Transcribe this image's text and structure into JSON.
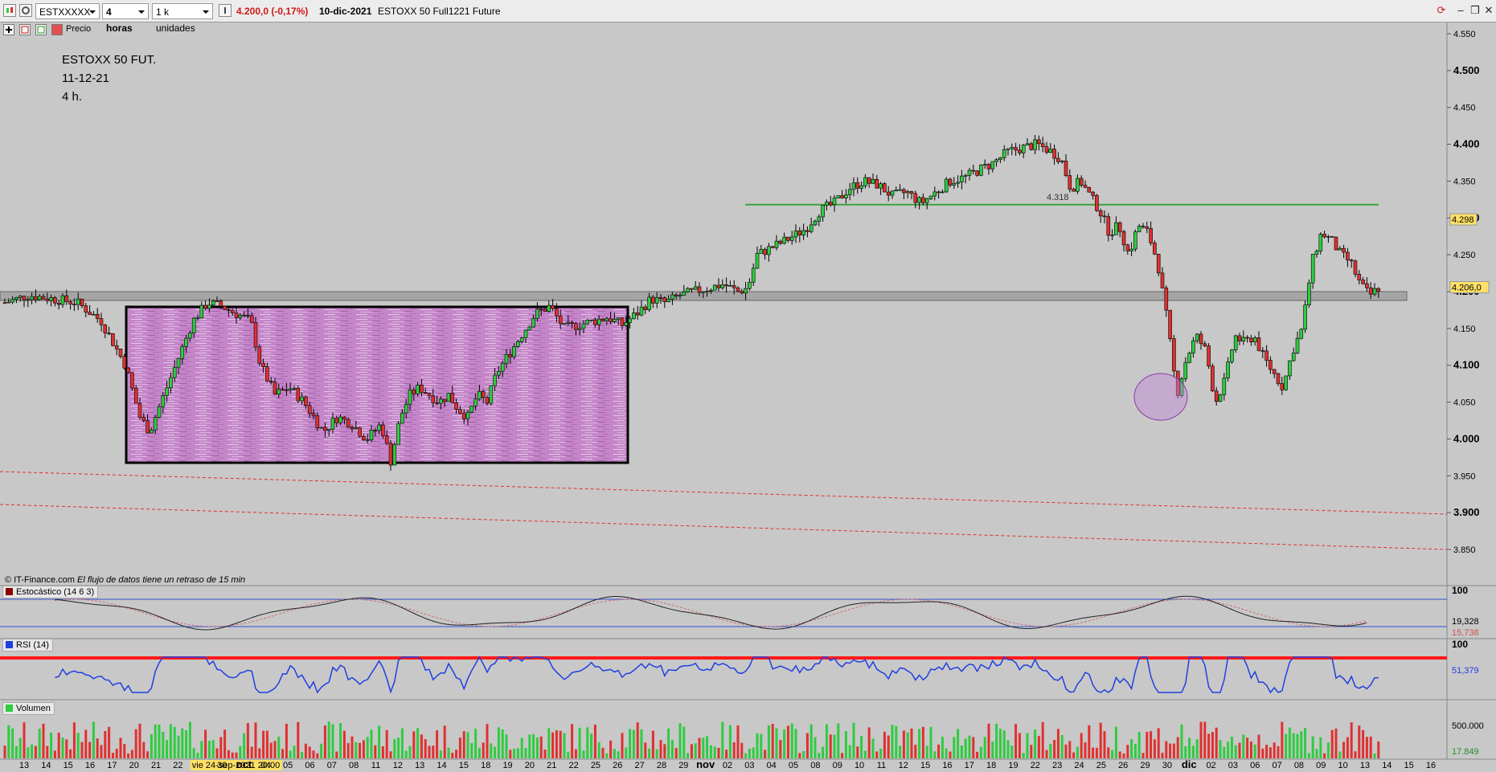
{
  "toolbar": {
    "symbol": "ESTXXXXX",
    "timeframe": "4 horas",
    "units": "1 k unidades",
    "price_change": "4.200,0 (-0,17%)",
    "date": "10-dic-2021",
    "instrument": "ESTOXX 50 Full1221 Future"
  },
  "chart_tools": {
    "price_label": "Precio"
  },
  "annotation": {
    "line1": "ESTOXX 50 FUT.",
    "line2": "11-12-21",
    "line3": "4 h."
  },
  "footer_note": {
    "source": "© IT-Finance.com",
    "delay": "El flujo de datos tiene un retraso de 15 min"
  },
  "chart_data": {
    "type": "candlestick",
    "ylim": [
      3830,
      4570
    ],
    "y_ticks": [
      "4.550",
      "4.500",
      "4.450",
      "4.400",
      "4.350",
      "4.300",
      "4.250",
      "4.200",
      "4.150",
      "4.100",
      "4.050",
      "4.000",
      "3.950",
      "3.900",
      "3.850"
    ],
    "last_price_label": "4.206,0",
    "level_labels": [
      "4.298",
      "4.318"
    ],
    "levels": {
      "resistance": 4318,
      "marker": 4298,
      "support_band": [
        4188,
        4200
      ]
    },
    "close_path": [
      [
        0,
        4185
      ],
      [
        25,
        4195
      ],
      [
        50,
        4190
      ],
      [
        75,
        4185
      ],
      [
        100,
        4160
      ],
      [
        125,
        4100
      ],
      [
        140,
        4030
      ],
      [
        150,
        4010
      ],
      [
        165,
        4060
      ],
      [
        180,
        4110
      ],
      [
        195,
        4160
      ],
      [
        210,
        4185
      ],
      [
        225,
        4180
      ],
      [
        240,
        4170
      ],
      [
        255,
        4160
      ],
      [
        265,
        4100
      ],
      [
        280,
        4060
      ],
      [
        295,
        4070
      ],
      [
        310,
        4050
      ],
      [
        330,
        4010
      ],
      [
        345,
        4030
      ],
      [
        360,
        4020
      ],
      [
        375,
        4000
      ],
      [
        390,
        4020
      ],
      [
        400,
        3970
      ],
      [
        410,
        4030
      ],
      [
        420,
        4060
      ],
      [
        430,
        4070
      ],
      [
        440,
        4060
      ],
      [
        450,
        4050
      ],
      [
        460,
        4060
      ],
      [
        470,
        4040
      ],
      [
        480,
        4030
      ],
      [
        490,
        4060
      ],
      [
        500,
        4050
      ],
      [
        510,
        4090
      ],
      [
        520,
        4110
      ],
      [
        535,
        4140
      ],
      [
        550,
        4170
      ],
      [
        565,
        4180
      ],
      [
        580,
        4150
      ],
      [
        595,
        4155
      ],
      [
        610,
        4160
      ],
      [
        625,
        4165
      ],
      [
        640,
        4155
      ],
      [
        655,
        4170
      ],
      [
        670,
        4190
      ],
      [
        685,
        4185
      ],
      [
        700,
        4195
      ],
      [
        715,
        4200
      ],
      [
        730,
        4205
      ],
      [
        745,
        4210
      ],
      [
        760,
        4200
      ],
      [
        770,
        4205
      ],
      [
        780,
        4250
      ],
      [
        795,
        4260
      ],
      [
        810,
        4270
      ],
      [
        830,
        4285
      ],
      [
        845,
        4310
      ],
      [
        860,
        4320
      ],
      [
        875,
        4340
      ],
      [
        890,
        4350
      ],
      [
        905,
        4345
      ],
      [
        920,
        4330
      ],
      [
        935,
        4335
      ],
      [
        950,
        4320
      ],
      [
        965,
        4335
      ],
      [
        980,
        4350
      ],
      [
        995,
        4355
      ],
      [
        1010,
        4365
      ],
      [
        1025,
        4375
      ],
      [
        1040,
        4390
      ],
      [
        1055,
        4395
      ],
      [
        1070,
        4400
      ],
      [
        1085,
        4390
      ],
      [
        1095,
        4380
      ],
      [
        1105,
        4340
      ],
      [
        1115,
        4350
      ],
      [
        1125,
        4330
      ],
      [
        1135,
        4310
      ],
      [
        1145,
        4280
      ],
      [
        1155,
        4290
      ],
      [
        1165,
        4250
      ],
      [
        1175,
        4290
      ],
      [
        1185,
        4280
      ],
      [
        1195,
        4240
      ],
      [
        1205,
        4160
      ],
      [
        1215,
        4060
      ],
      [
        1225,
        4110
      ],
      [
        1235,
        4140
      ],
      [
        1245,
        4120
      ],
      [
        1255,
        4050
      ],
      [
        1265,
        4080
      ],
      [
        1275,
        4140
      ],
      [
        1285,
        4130
      ],
      [
        1295,
        4140
      ],
      [
        1305,
        4110
      ],
      [
        1315,
        4090
      ],
      [
        1325,
        4070
      ],
      [
        1335,
        4120
      ],
      [
        1345,
        4150
      ],
      [
        1355,
        4240
      ],
      [
        1365,
        4280
      ],
      [
        1375,
        4270
      ],
      [
        1385,
        4250
      ],
      [
        1395,
        4240
      ],
      [
        1405,
        4210
      ],
      [
        1415,
        4195
      ],
      [
        1425,
        4206
      ]
    ],
    "x_labels": [
      "13",
      "14",
      "15",
      "16",
      "17",
      "20",
      "21",
      "22",
      "vie 24-sep-2021 20:00",
      "30",
      "oct",
      "04",
      "05",
      "06",
      "07",
      "08",
      "11",
      "12",
      "13",
      "14",
      "15",
      "18",
      "19",
      "20",
      "21",
      "22",
      "25",
      "26",
      "27",
      "28",
      "29",
      "nov",
      "02",
      "03",
      "04",
      "05",
      "08",
      "09",
      "10",
      "11",
      "12",
      "15",
      "16",
      "17",
      "18",
      "19",
      "22",
      "23",
      "24",
      "25",
      "26",
      "29",
      "30",
      "dic",
      "02",
      "03",
      "06",
      "07",
      "08",
      "09",
      "10",
      "13",
      "14",
      "15",
      "16"
    ]
  },
  "stochastic": {
    "label": "Estocástico (14 6 3)",
    "value1": "19,328",
    "value2": "15,738",
    "top_tick": "100"
  },
  "rsi": {
    "label": "RSI (14)",
    "value": "51,379",
    "top_tick": "100"
  },
  "volume": {
    "label": "Volumen",
    "tick": "500.000",
    "value": "17.849"
  },
  "colors": {
    "up": "#2ecc40",
    "down": "#e03030",
    "box_fill": "#c084c8",
    "resistance": "#3aa33a",
    "band": "#a0a0a0"
  }
}
